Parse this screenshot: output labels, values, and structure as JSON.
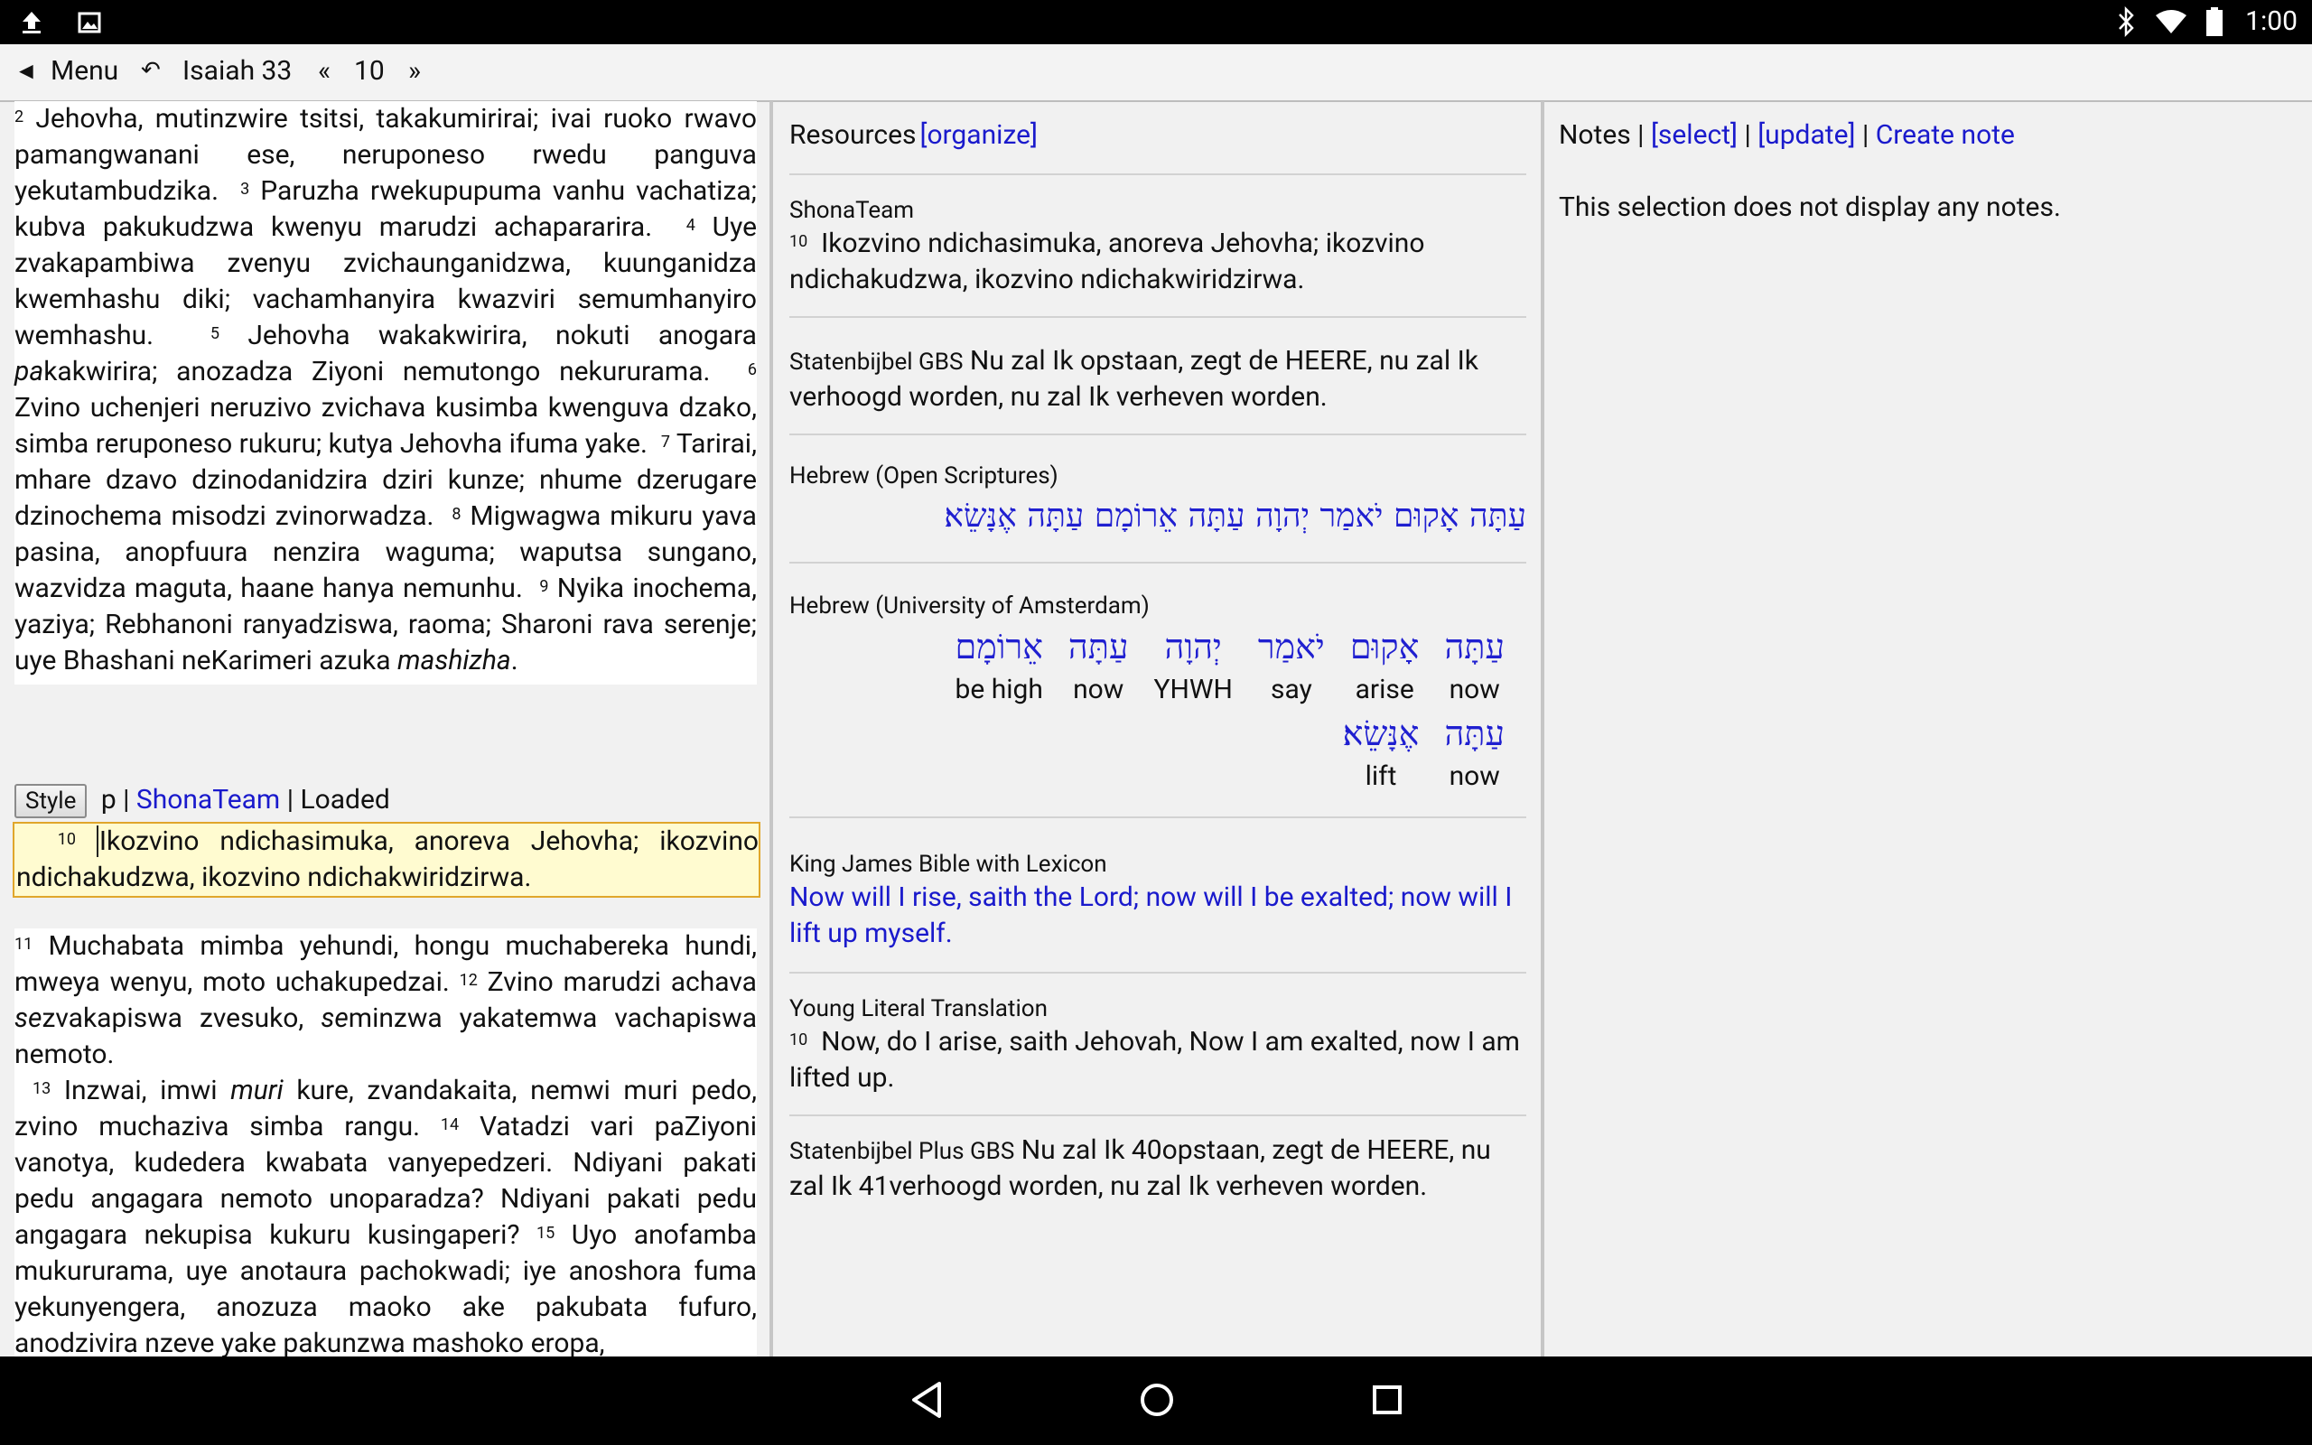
{
  "status_bar": {
    "time": "1:00"
  },
  "toolbar": {
    "back_label": "◄",
    "menu_label": "Menu",
    "history_glyph": "↶",
    "book_chapter": "Isaiah 33",
    "prev_label": "«",
    "verse": "10",
    "next_label": "»"
  },
  "left": {
    "top_verses": [
      {
        "num": "2",
        "text": "Jehovha, mutinzwire tsitsi, takakumirirai; ivai ruoko rwavo pamangwanani ese, neruponeso rwedu panguva yekutambudzika."
      },
      {
        "num": "3",
        "text": "Paruzha rwekupupuma vanhu vachatiza; kubva pakukudzwa kwenyu marudzi achapararira."
      },
      {
        "num": "4",
        "text": "Uye zvakapambiwa zvenyu zvichaunganidzwa, kuunganidza kwemhashu diki; vachamhanyira kwazviri semumhanyiro wemhashu."
      },
      {
        "num": "5",
        "text_before": "Jehovha wakakwirira, nokuti anogara ",
        "text_italic": "pa",
        "text_after": "kakwirira; anozadza Ziyoni nemutongo nekururama."
      },
      {
        "num": "6",
        "text": "Zvino uchenjeri neruzivo zvichava kusimba kwenguva dzako, simba reruponeso rukuru; kutya Jehovha ifuma yake."
      },
      {
        "num": "7",
        "text": "Tarirai, mhare dzavo dzinodanidzira dziri kunze; nhume dzerugare dzinochema misodzi zvinorwadza."
      },
      {
        "num": "8",
        "text": "Migwagwa mikuru yava pasina, anopfuura nenzira waguma; waputsa sungano, wazvidza maguta, haane hanya nemunhu."
      },
      {
        "num": "9",
        "text_before": "Nyika inochema, yaziya; Rebhanoni ranyadziswa, raoma; Sharoni rava serenje; uye Bhashani neKarimeri azuka ",
        "text_italic": "mashizha",
        "text_after": "."
      }
    ],
    "style_button": "Style",
    "style_tag": "p",
    "style_sep1": "|",
    "style_link": "ShonaTeam",
    "style_sep2": "|",
    "style_status": "Loaded",
    "edit_verse_num": "10",
    "edit_verse_text": "Ikozvino ndichasimuka, anoreva Jehovha; ikozvino ndichakudzwa, ikozvino ndichakwiridzirwa.",
    "bottom_verses": [
      {
        "num": "11",
        "text": "Muchabata mimba yehundi, hongu muchabereka hundi, mweya wenyu, moto uchakupedzai."
      },
      {
        "num": "12",
        "parts": [
          "Zvino marudzi achava ",
          "se",
          "zvakapiswa zvesuko, ",
          "se",
          "minzwa yakatemwa vachapiswa nemoto."
        ]
      },
      {
        "num": "13",
        "parts": [
          "Inzwai, imwi ",
          "muri",
          " kure, zvandakaita, nemwi muri pedo, zvino muchaziva simba rangu."
        ]
      },
      {
        "num": "14",
        "text": "Vatadzi vari paZiyoni vanotya, kudedera kwabata vanyepedzeri. Ndiyani pakati pedu angagara nemoto unoparadza? Ndiyani pakati pedu angagara nekupisa kukuru kusingaperi?"
      },
      {
        "num": "15",
        "text": "Uyo anofamba mukururama, uye anotaura pachokwadi; iye anoshora fuma yekunyengera, anozuza maoko ake pakubata fufuro, anodzivira nzeve yake pakunzwa mashoko eropa,"
      }
    ]
  },
  "middle": {
    "header_label": "Resources",
    "organize_link": "[organize]",
    "blocks": [
      {
        "title": "ShonaTeam",
        "num": "10",
        "text": "Ikozvino ndichasimuka, anoreva Jehovha; ikozvino ndichakudzwa, ikozvino ndichakwiridzirwa."
      },
      {
        "title": "Statenbijbel GBS",
        "text": "Nu zal Ik opstaan, zegt de HEERE, nu zal Ik verhoogd worden, nu zal Ik verheven worden."
      },
      {
        "title": "Hebrew (Open Scriptures)",
        "hebrew": "עַתָּה אָקוּם יֹאמַר יְהוָה עַתָּה אֵרוֹמָם עַתָּה אֶנָּשֵׂא׃"
      },
      {
        "title": "Hebrew (University of Amsterdam)",
        "interlinear": [
          {
            "h": "עַתָּה",
            "g": "now"
          },
          {
            "h": "אָקוּם",
            "g": "arise"
          },
          {
            "h": "יֹאמַר",
            "g": "say"
          },
          {
            "h": "יְהוָה",
            "g": "YHWH"
          },
          {
            "h": "עַתָּה",
            "g": "now"
          },
          {
            "h": "אֵרוֹמָם",
            "g": "be high"
          },
          {
            "h": "עַתָּה",
            "g": "now"
          },
          {
            "h": "אֶנָּשֵׂא׃",
            "g": "lift"
          }
        ]
      },
      {
        "title": "King James Bible with Lexicon",
        "link_text": "Now will I rise, saith the Lord; now will I be exalted; now will I lift up myself."
      },
      {
        "title": "Young Literal Translation",
        "num": "10",
        "text": "Now, do I arise, saith Jehovah, Now I am exalted, now I am lifted up."
      },
      {
        "title": "Statenbijbel Plus GBS",
        "text": "Nu zal Ik 40opstaan, zegt de HEERE, nu zal Ik 41verhoogd worden, nu zal Ik verheven worden."
      }
    ]
  },
  "right": {
    "notes_label": "Notes",
    "sep": "|",
    "select_link": "[select]",
    "update_link": "[update]",
    "create_link": "Create note",
    "empty_message": "This selection does not display any notes."
  }
}
